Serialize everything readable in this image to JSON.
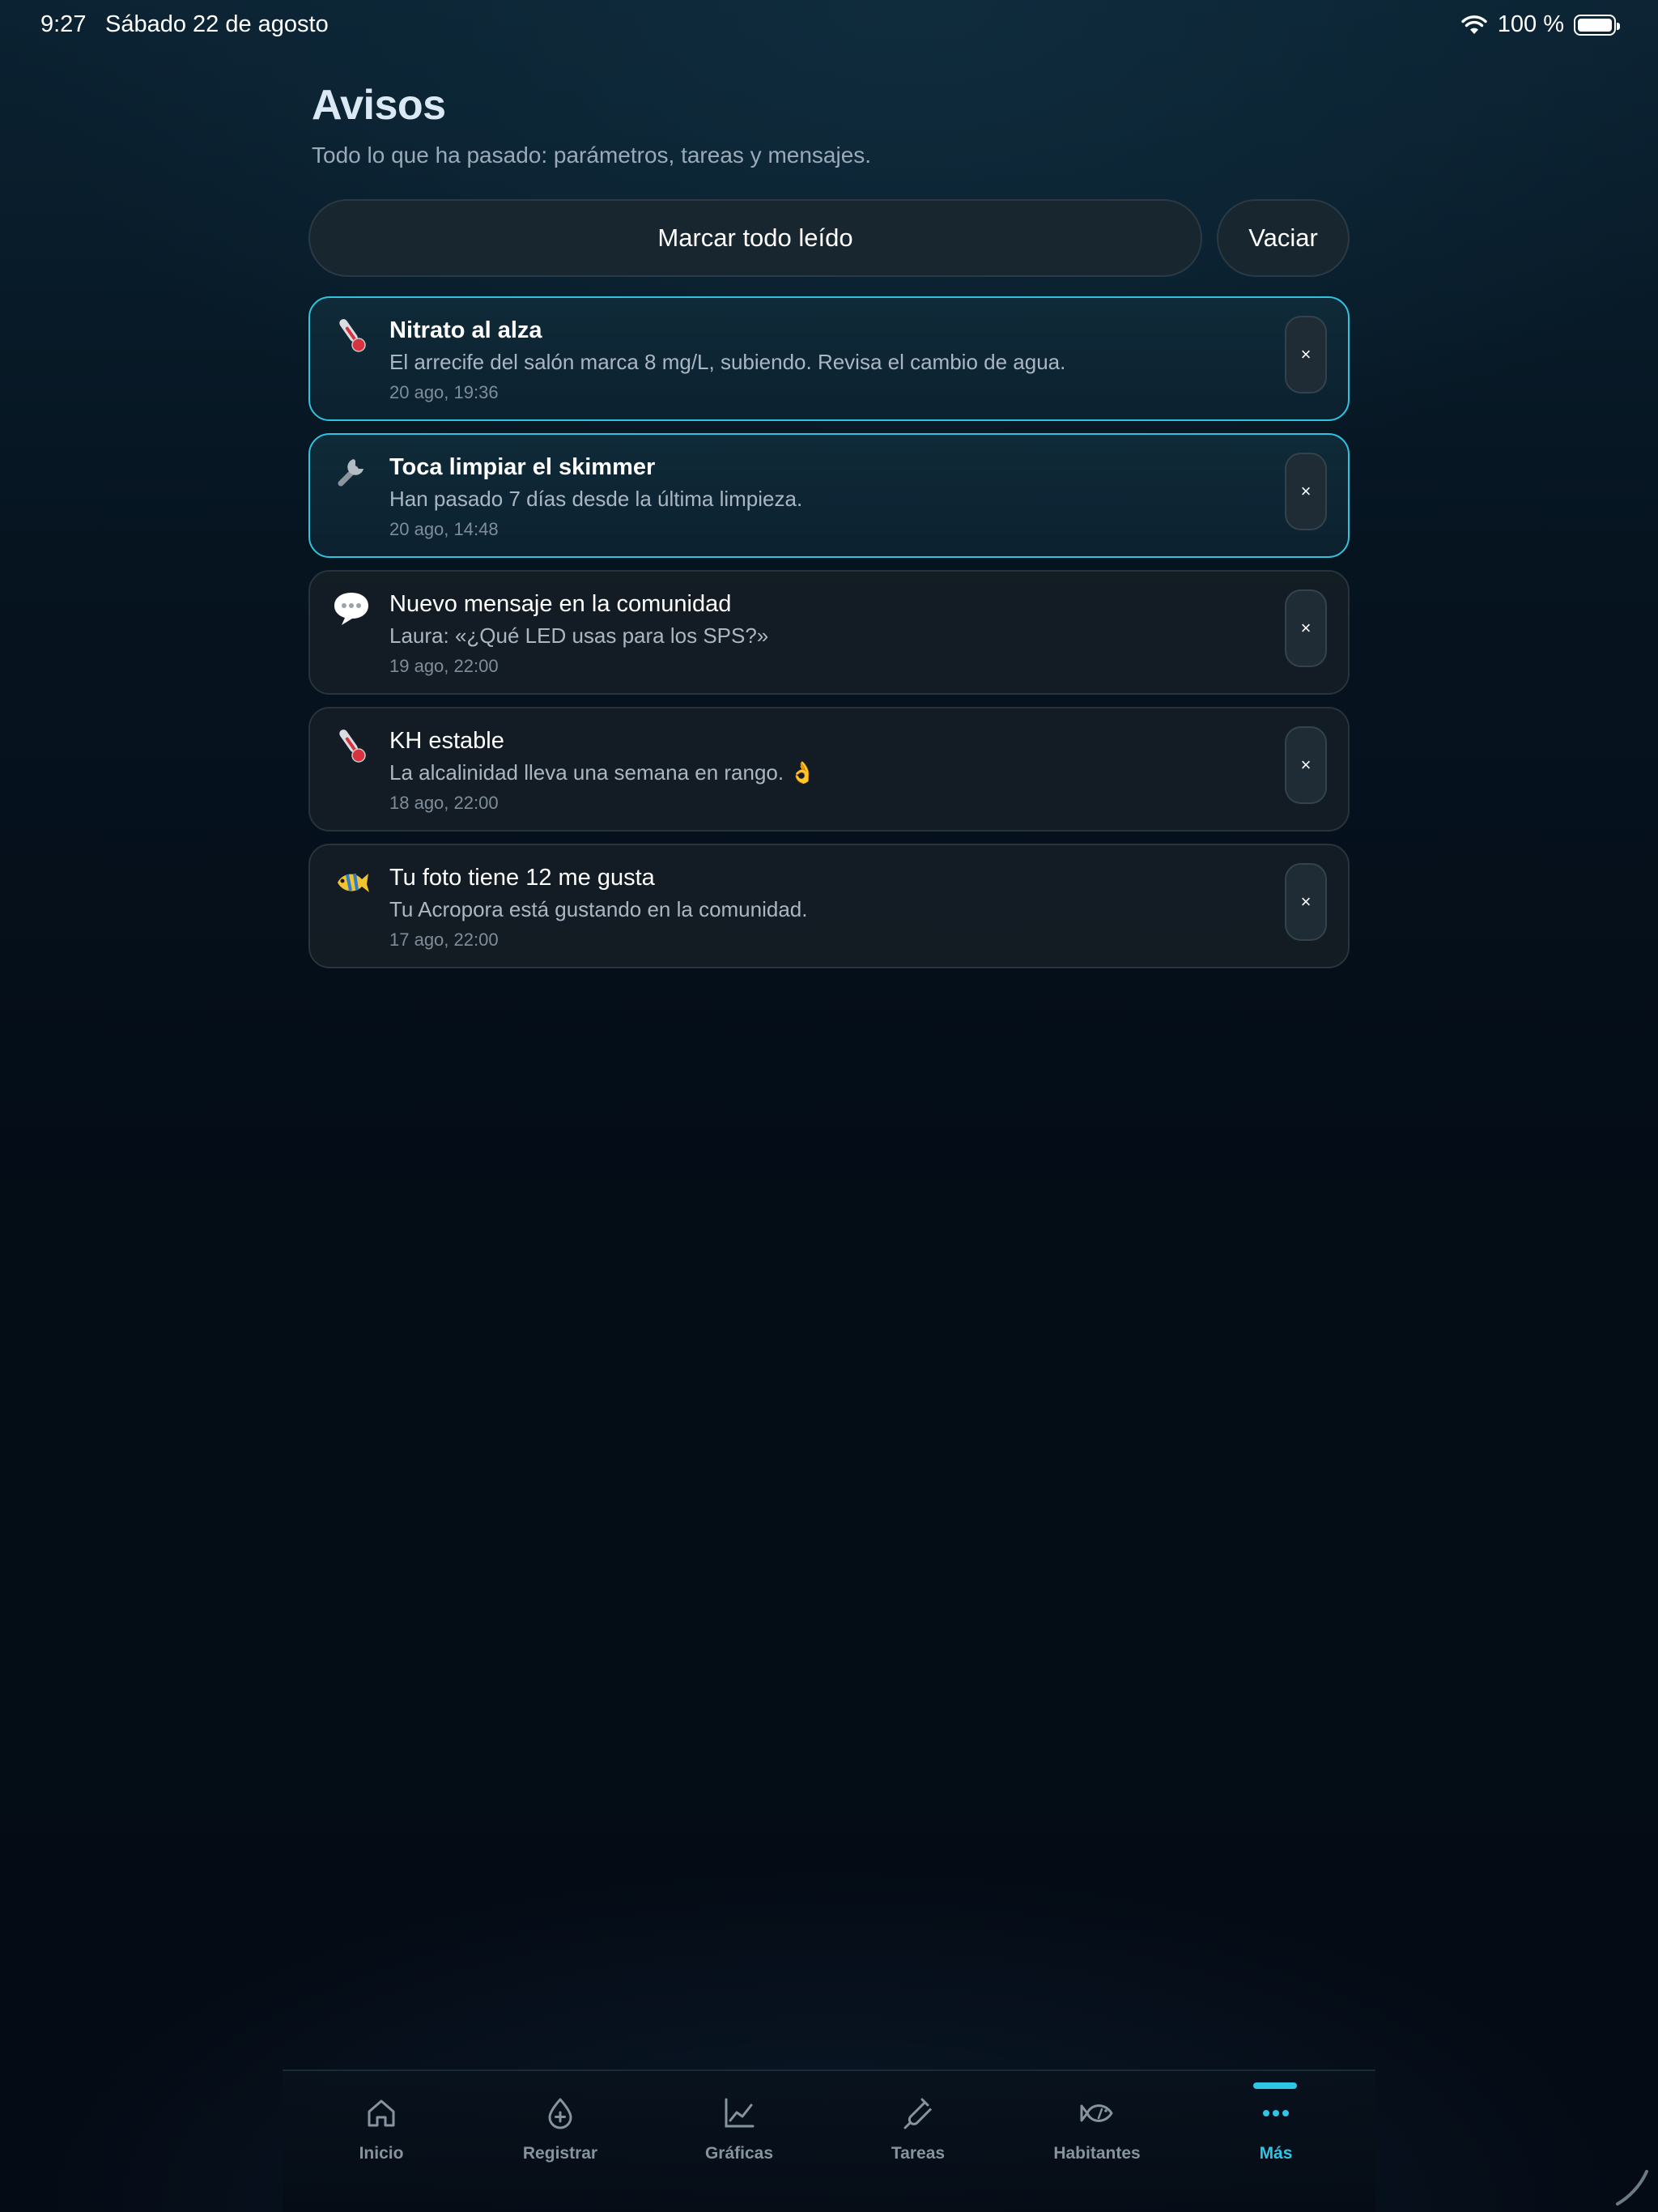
{
  "status_bar": {
    "time": "9:27",
    "date": "Sábado 22 de agosto",
    "battery": "100 %"
  },
  "header": {
    "title": "Avisos",
    "subtitle": "Todo lo que ha pasado: parámetros, tareas y mensajes."
  },
  "actions": {
    "mark_all_read": "Marcar todo leído",
    "clear": "Vaciar"
  },
  "notifications": [
    {
      "icon": "thermometer-icon",
      "title": "Nitrato al alza",
      "body": "El arrecife del salón marca 8 mg/L, subiendo. Revisa el cambio de agua.",
      "time": "20 ago, 19:36",
      "unread": true,
      "close": "×"
    },
    {
      "icon": "wrench-icon",
      "title": "Toca limpiar el skimmer",
      "body": "Han pasado 7 días desde la última limpieza.",
      "time": "20 ago, 14:48",
      "unread": true,
      "close": "×"
    },
    {
      "icon": "speech-bubble-icon",
      "title": "Nuevo mensaje en la comunidad",
      "body": "Laura: «¿Qué LED usas para los SPS?»",
      "time": "19 ago, 22:00",
      "unread": false,
      "close": "×"
    },
    {
      "icon": "thermometer-icon",
      "title": "KH estable",
      "body": "La alcalinidad lleva una semana en rango. 👌",
      "time": "18 ago, 22:00",
      "unread": false,
      "close": "×"
    },
    {
      "icon": "tropical-fish-icon",
      "title": "Tu foto tiene 12 me gusta",
      "body": "Tu Acropora está gustando en la comunidad.",
      "time": "17 ago, 22:00",
      "unread": false,
      "close": "×"
    }
  ],
  "tabbar": {
    "items": [
      {
        "label": "Inicio",
        "icon": "home-icon"
      },
      {
        "label": "Registrar",
        "icon": "drop-plus-icon"
      },
      {
        "label": "Gráficas",
        "icon": "line-chart-icon"
      },
      {
        "label": "Tareas",
        "icon": "test-tube-icon"
      },
      {
        "label": "Habitantes",
        "icon": "fish-icon"
      },
      {
        "label": "Más",
        "icon": "more-dots-icon"
      }
    ],
    "active_index": 5
  },
  "colors": {
    "accent": "#2ec6e6",
    "unread_border": "#2fc3dc",
    "inactive_tab": "#8694a0"
  }
}
